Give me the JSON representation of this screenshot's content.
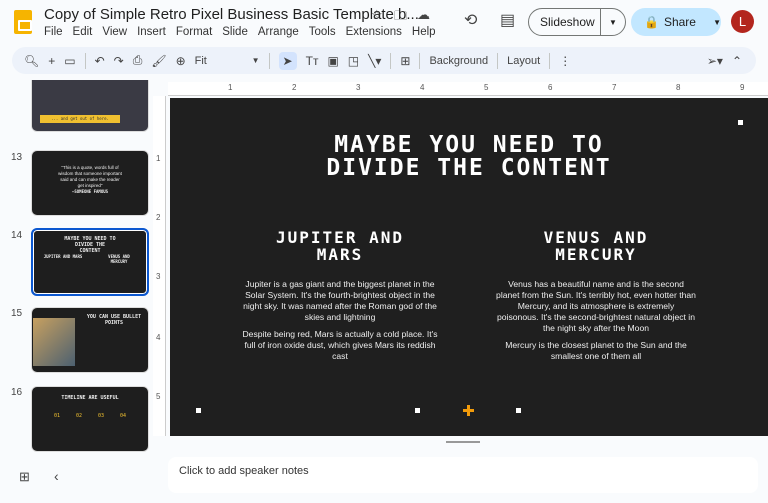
{
  "doc": {
    "title": "Copy of Simple Retro Pixel Business Basic Template b...",
    "menu": [
      "File",
      "Edit",
      "View",
      "Insert",
      "Format",
      "Slide",
      "Arrange",
      "Tools",
      "Extensions",
      "Help"
    ]
  },
  "header": {
    "slideshow": "Slideshow",
    "share": "Share",
    "avatar": "L"
  },
  "toolbar": {
    "zoom": "Fit",
    "background": "Background",
    "layout": "Layout"
  },
  "thumbnails": [
    {
      "num": "",
      "text": "... and get out of here."
    },
    {
      "num": "13",
      "quote": "\"This is a quote, words full of wisdom that someone important said and can make the reader get inspired\"",
      "author": "—SOMEONE FAMOUS"
    },
    {
      "num": "14",
      "title": "MAYBE YOU NEED TO DIVIDE THE CONTENT",
      "c1": "JUPITER AND MARS",
      "c2": "VENUS AND MERCURY"
    },
    {
      "num": "15",
      "title": "YOU CAN USE BULLET POINTS"
    },
    {
      "num": "16",
      "title": "TIMELINE ARE USEFUL",
      "steps": [
        "01",
        "02",
        "03",
        "04"
      ]
    }
  ],
  "ruler": {
    "h": [
      "1",
      "2",
      "3",
      "4",
      "5",
      "6",
      "7",
      "8",
      "9"
    ],
    "v": [
      "1",
      "2",
      "3",
      "4",
      "5"
    ]
  },
  "slide": {
    "title1": "MAYBE YOU NEED TO",
    "title2": "DIVIDE THE CONTENT",
    "left": {
      "h1": "JUPITER AND",
      "h2": "MARS",
      "p1": "Jupiter is a gas giant and the biggest planet in the Solar System. It's the fourth-brightest object in the night sky.  It was named after the Roman god of the skies and lightning",
      "p2": "Despite being red, Mars is actually a cold place. It's full of iron oxide dust, which gives Mars its reddish cast"
    },
    "right": {
      "h1": "VENUS AND",
      "h2": "MERCURY",
      "p1": "Venus has a beautiful name and is the second planet from the Sun. It's terribly hot, even hotter than Mercury, and its atmosphere is extremely poisonous. It's the second-brightest natural object in the night sky after the Moon",
      "p2": "Mercury is the closest planet to the Sun and the smallest one of them all"
    },
    "accent": "#f29b0a"
  },
  "notes": {
    "placeholder": "Click to add speaker notes"
  }
}
